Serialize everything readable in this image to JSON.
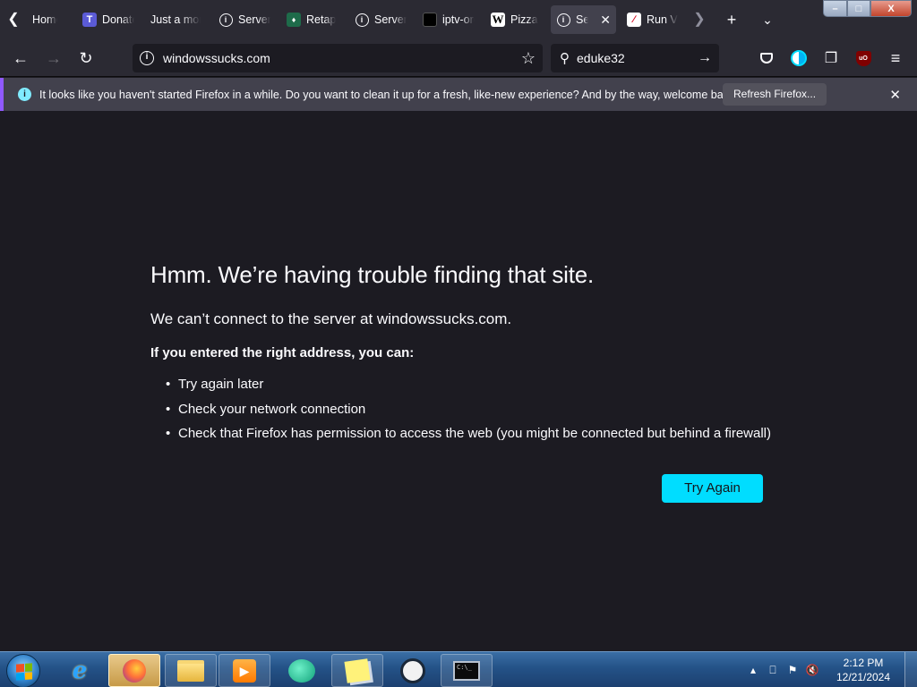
{
  "tabs": [
    {
      "title": "Home",
      "favicon": "home-favicon"
    },
    {
      "title": "Donate",
      "favicon": "T"
    },
    {
      "title": "Just a moment...",
      "favicon": ""
    },
    {
      "title": "Server Not Found",
      "favicon": "info-icon"
    },
    {
      "title": "Retap",
      "favicon": "retap-favicon"
    },
    {
      "title": "Server Not Found",
      "favicon": "info-icon"
    },
    {
      "title": "iptv-org",
      "favicon": "black-square"
    },
    {
      "title": "Pizza",
      "favicon": "W"
    },
    {
      "title": "Server Not Found",
      "favicon": "info-icon",
      "active": true
    },
    {
      "title": "Run V",
      "favicon": "red-n-favicon"
    }
  ],
  "window_controls": {
    "minimize": "–",
    "maximize": "□",
    "close": "X"
  },
  "navbar": {
    "url": "windowssucks.com",
    "search_value": "eduke32"
  },
  "notification": {
    "message": "It looks like you haven't started Firefox in a while. Do you want to clean it up for a fresh, like-new experience? And by the way, welcome back!",
    "button_label": "Refresh Firefox..."
  },
  "error_page": {
    "title": "Hmm. We’re having trouble finding that site.",
    "subtitle": "We can’t connect to the server at windowssucks.com.",
    "hint": "If you entered the right address, you can:",
    "suggestions": [
      "Try again later",
      "Check your network connection",
      "Check that Firefox has permission to access the web (you might be connected but behind a firewall)"
    ],
    "button_label": "Try Again"
  },
  "taskbar": {
    "cmd_text": "C:\\_",
    "clock_time": "2:12 PM",
    "clock_date": "12/21/2024"
  },
  "colors": {
    "accent": "#00ddff",
    "page_bg": "#1c1b22",
    "toolbar_bg": "#2b2a33",
    "notification_bg": "#42414d",
    "notification_accent": "#9059ff"
  }
}
